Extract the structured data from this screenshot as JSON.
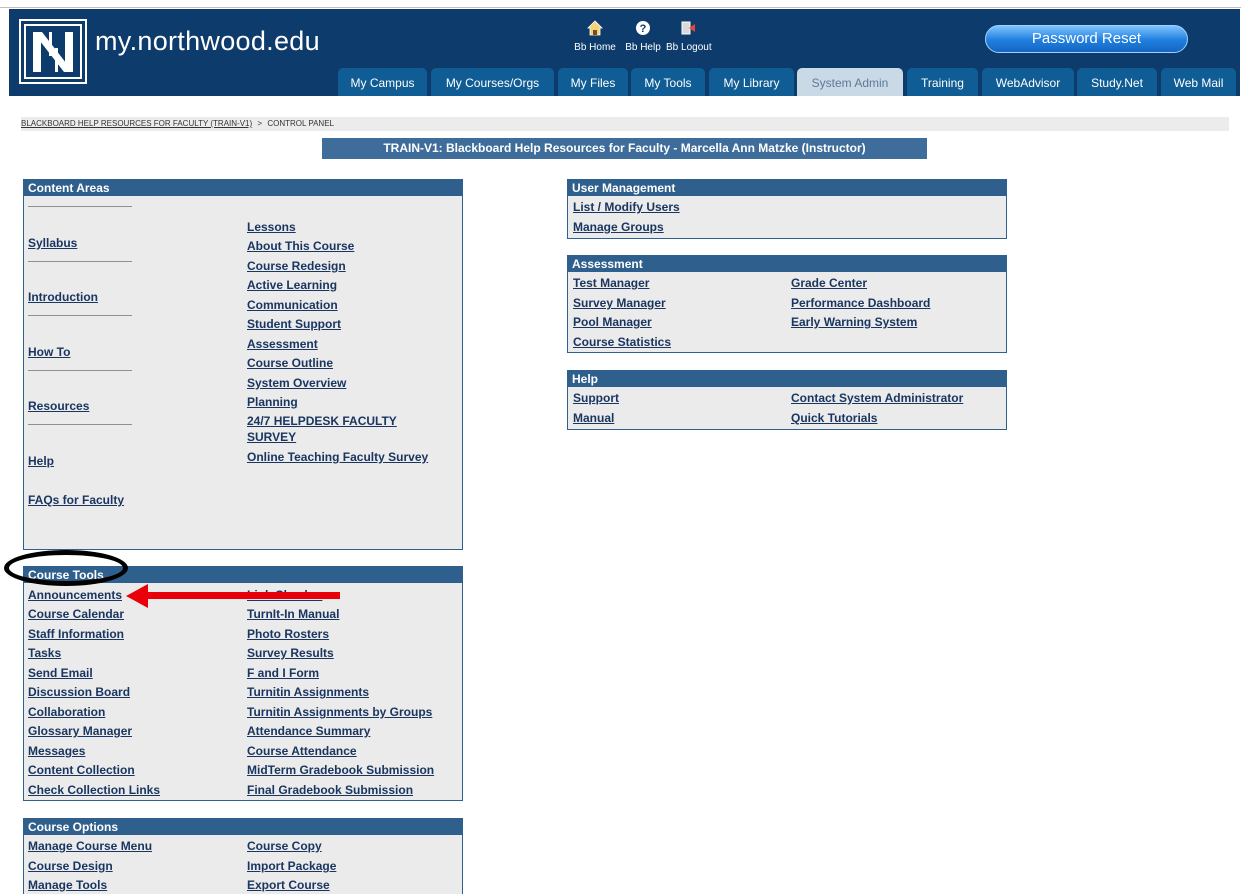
{
  "brand": {
    "name": "my.northwood.edu",
    "logo_letter": "N"
  },
  "utilities": [
    {
      "label": "Bb Home",
      "icon": "home-icon"
    },
    {
      "label": "Bb Help",
      "icon": "help-icon"
    },
    {
      "label": "Bb Logout",
      "icon": "logout-icon"
    }
  ],
  "password_reset": "Password Reset",
  "tabs": [
    "My Campus",
    "My Courses/Orgs",
    "My Files",
    "My Tools",
    "My Library",
    "System Admin",
    "Training",
    "WebAdvisor",
    "Study.Net",
    "Web Mail"
  ],
  "active_tab": "System Admin",
  "breadcrumb": {
    "course": "BLACKBOARD HELP RESOURCES FOR FACULTY (TRAIN-V1)",
    "separator": ">",
    "current": "CONTROL PANEL"
  },
  "course_title": "TRAIN-V1: Blackboard Help Resources for Faculty - Marcella Ann Matzke (Instructor)",
  "content_areas": {
    "title": "Content Areas",
    "left": [
      "Syllabus",
      "Introduction",
      "How To",
      "Resources",
      "Help",
      "FAQs for Faculty"
    ],
    "right": [
      "Lessons",
      "About This Course",
      "Course Redesign",
      "Active Learning",
      "Communication",
      "Student Support",
      "Assessment",
      "Course Outline ",
      "System Overview",
      "Planning",
      "24/7 HELPDESK FACULTY",
      "SURVEY",
      "Online Teaching Faculty Survey"
    ]
  },
  "course_tools": {
    "title": "Course Tools",
    "left": [
      "Announcements",
      "Course Calendar",
      "Staff Information",
      "Tasks",
      "Send Email",
      "Discussion Board",
      "Collaboration",
      "Glossary Manager",
      "Messages",
      "Content Collection",
      "Check Collection Links"
    ],
    "right": [
      "Link Checker",
      "TurnIt-In Manual",
      "Photo Rosters",
      "Survey Results",
      "F and I Form",
      "Turnitin Assignments",
      "Turnitin Assignments by Groups",
      "Attendance Summary",
      "Course Attendance",
      "MidTerm Gradebook Submission",
      "Final Gradebook Submission"
    ]
  },
  "course_options": {
    "title": "Course Options",
    "left": [
      "Manage Course Menu",
      "Course Design",
      "Manage Tools"
    ],
    "right": [
      "Course Copy",
      "Import Package",
      "Export Course"
    ]
  },
  "user_management": {
    "title": "User Management",
    "links": [
      "List / Modify Users",
      "Manage Groups"
    ]
  },
  "assessment": {
    "title": "Assessment",
    "left": [
      "Test Manager",
      "Survey Manager",
      "Pool Manager",
      "Course Statistics"
    ],
    "right": [
      "Grade Center",
      "Performance Dashboard",
      "Early Warning System"
    ]
  },
  "help": {
    "title": "Help",
    "left": [
      "Support",
      "Manual"
    ],
    "right": [
      "Contact System Administrator",
      "Quick Tutorials"
    ]
  },
  "colors": {
    "header": "#0d3b6b",
    "tab": "#0f5d94",
    "active_tab": "#c9d9e6",
    "panel_head": "#2f5f8c",
    "link": "#1a3660",
    "annotation": "#e8000a"
  }
}
